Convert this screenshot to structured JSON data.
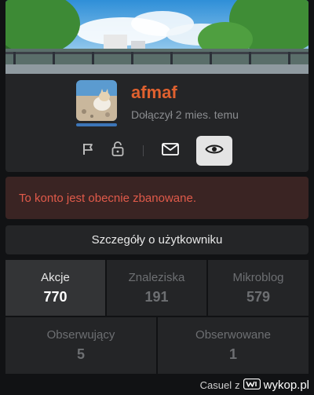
{
  "profile": {
    "username": "afmaf",
    "joined": "Dołączył 2 mies. temu"
  },
  "actions": {
    "icons": [
      "flag-icon",
      "lock-icon",
      "mail-icon",
      "eye-icon"
    ],
    "active": "observe"
  },
  "ban_notice": "To konto jest obecnie zbanowane.",
  "details_button": "Szczegóły o użytkowniku",
  "stats": [
    {
      "label": "Akcje",
      "value": "770"
    },
    {
      "label": "Znaleziska",
      "value": "191"
    },
    {
      "label": "Mikroblog",
      "value": "579"
    },
    {
      "label": "Obserwujący",
      "value": "5"
    },
    {
      "label": "Obserwowane",
      "value": "1"
    }
  ],
  "footer": {
    "author": "Casuel",
    "separator": "z",
    "brand": "wykop.pl"
  },
  "colors": {
    "accent": "#e0612f",
    "ban_text": "#e05a4a",
    "avatar_bar": "#3c75b8"
  }
}
